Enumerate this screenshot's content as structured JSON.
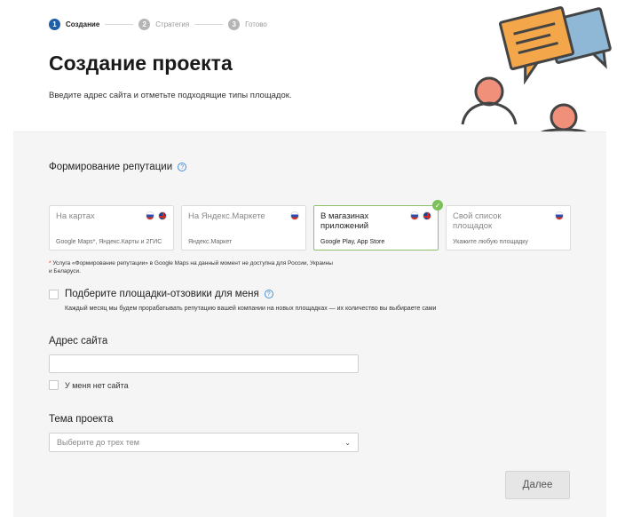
{
  "stepper": {
    "steps": [
      {
        "num": "1",
        "label": "Создание"
      },
      {
        "num": "2",
        "label": "Стратегия"
      },
      {
        "num": "3",
        "label": "Готово"
      }
    ]
  },
  "header": {
    "title": "Создание проекта",
    "subtitle": "Введите адрес сайта и отметьте подходящие типы площадок."
  },
  "reputation": {
    "title": "Формирование репутации",
    "help_icon": "?",
    "cards": [
      {
        "title": "На картах",
        "desc": "Google Maps*, Яндекс.Карты и 2ГИС",
        "flags": [
          "ru",
          "uk"
        ],
        "selected": false
      },
      {
        "title": "На Яндекс.Маркете",
        "desc": "Яндекс.Маркет",
        "flags": [
          "ru"
        ],
        "selected": false
      },
      {
        "title": "В магазинах приложений",
        "desc": "Google Play, App Store",
        "flags": [
          "ru",
          "uk"
        ],
        "selected": true
      },
      {
        "title": "Свой список площадок",
        "desc": "Укажите любую площадку",
        "flags": [
          "ru"
        ],
        "selected": false
      }
    ],
    "selected_check": "✓",
    "footnote_star": "*",
    "footnote": " Услуга «Формирование репутации» в Google Maps на данный момент не доступна для России, Украины и Беларуси."
  },
  "auto_pick": {
    "label": "Подберите площадки-отзовики для меня",
    "help_icon": "?",
    "desc": "Каждый месяц мы будем прорабатывать репутацию вашей компании на новых площадках — их количество вы выбираете сами"
  },
  "site": {
    "label": "Адрес сайта",
    "value": "",
    "no_site_label": "У меня нет сайта"
  },
  "topic": {
    "label": "Тема проекта",
    "placeholder": "Выберите до трех тем",
    "chevron": "⌄"
  },
  "next_button": "Далее",
  "colors": {
    "accent": "#1f5fa8",
    "selected_border": "#8dc26a",
    "help": "#4a8fd6"
  }
}
